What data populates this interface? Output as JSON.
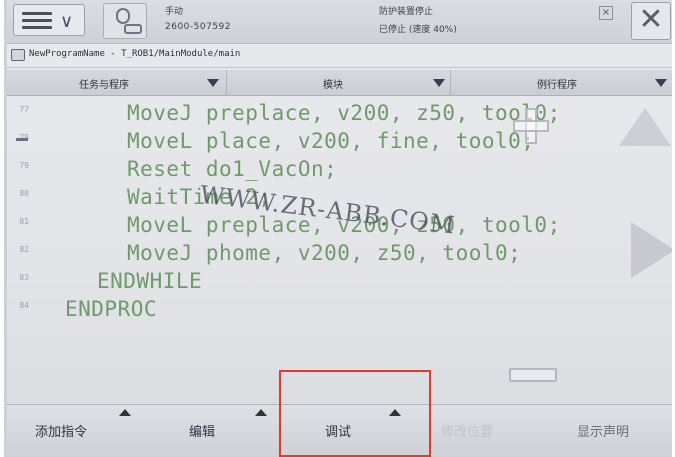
{
  "topbar": {
    "status_line1": "手动",
    "status_line2": "2600-507592",
    "status_line3": "防护装置停止",
    "status_line4": "已停止 (速度 40%)"
  },
  "breadcrumb": {
    "path": "NewProgramName - T_ROB1/MainModule/main"
  },
  "tabs": [
    {
      "label": "任务与程序"
    },
    {
      "label": "模块"
    },
    {
      "label": "例行程序"
    }
  ],
  "code": {
    "line_numbers": [
      "77",
      "78",
      "79",
      "80",
      "81",
      "82",
      "83",
      "84"
    ],
    "lines": [
      "MoveJ preplace, v200, z50, tool0;",
      "MoveL place, v200, fine, tool0;",
      "Reset do1_VacOn;",
      "WaitTime 2;",
      "MoveL preplace, v200, z50, tool0;",
      "MoveJ phome, v200, z50, tool0;",
      "ENDWHILE",
      "ENDPROC"
    ]
  },
  "watermark": "WWW.ZR-ABB.COM",
  "bottom_toolbar": {
    "add_instruction": "添加指令",
    "edit": "编辑",
    "debug": "调试",
    "modify_position": "修改位置",
    "show_declaration": "显示声明"
  },
  "colors": {
    "code_text": "#6f9a6a",
    "highlight_box": "#e03a31"
  }
}
